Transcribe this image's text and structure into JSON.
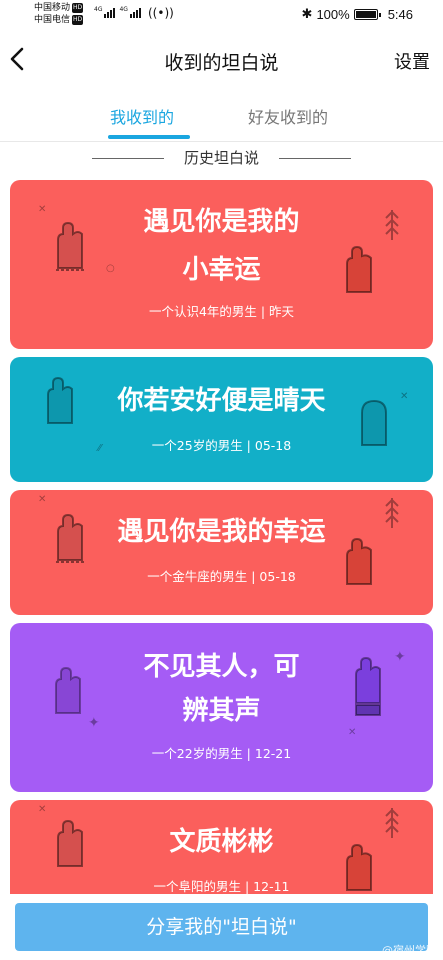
{
  "status_bar": {
    "carrier1": "中国移动",
    "carrier2": "中国电信",
    "hd": "HD",
    "net1": "4G",
    "net2": "4G",
    "battery_text": "100%",
    "time": "5:46"
  },
  "header": {
    "title": "收到的坦白说",
    "settings_label": "设置"
  },
  "tabs": [
    {
      "label": "我收到的",
      "active": true
    },
    {
      "label": "好友收到的",
      "active": false
    }
  ],
  "section_title": "历史坦白说",
  "cards": [
    {
      "line1": "遇见你是我的",
      "line2": "小幸运",
      "meta": "一个认识4年的男生 | 昨天",
      "color": "#fb5f5c"
    },
    {
      "line1": "你若安好便是晴天",
      "line2": "",
      "meta": "一个25岁的男生 | 05-18",
      "color": "#12afc8"
    },
    {
      "line1": "遇见你是我的幸运",
      "line2": "",
      "meta": "一个金牛座的男生 | 05-18",
      "color": "#fb5f5c"
    },
    {
      "line1": "不见其人，可",
      "line2": "辨其声",
      "meta": "一个22岁的男生 | 12-21",
      "color": "#a55cf5"
    },
    {
      "line1": "文质彬彬",
      "line2": "",
      "meta": "一个阜阳的男生 | 12-11",
      "color": "#fb5f5c"
    }
  ],
  "bottom": {
    "share_label": "分享我的\"坦白说\"",
    "watermark": "@宿州学院"
  },
  "icons": [
    "back-arrow-icon",
    "fist-hand-icon",
    "raised-hand-icon",
    "tree-icon",
    "sparkle-icon"
  ]
}
